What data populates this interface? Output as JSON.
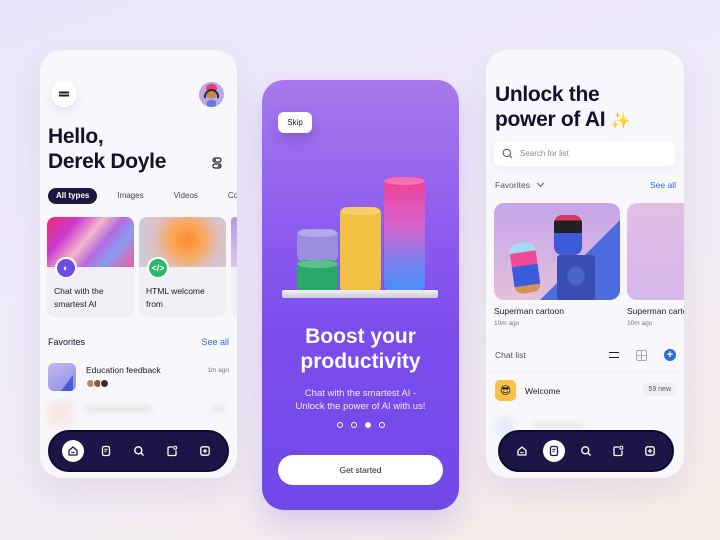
{
  "left_screen": {
    "menu_icon": "hamburger-menu-icon",
    "avatar_alt": "user-avatar",
    "greeting_line1": "Hello,",
    "greeting_line2": "Derek Doyle",
    "filter_icon": "filter-sliders-icon",
    "chips": [
      {
        "label": "All types",
        "active": true
      },
      {
        "label": "Images",
        "active": false
      },
      {
        "label": "Videos",
        "active": false
      },
      {
        "label": "Conter",
        "active": false
      }
    ],
    "cards": [
      {
        "title": "Chat with the smartest AI",
        "icon": "ai-chat-icon",
        "badge_glyph": "◐"
      },
      {
        "title": "HTML welcome from",
        "icon": "code-icon",
        "badge_glyph": "</>"
      }
    ],
    "favorites": {
      "heading": "Favorites",
      "see_all": "See all",
      "items": [
        {
          "title": "Education feedback",
          "time": "1m ago"
        }
      ]
    },
    "nav": {
      "items": [
        "home",
        "document",
        "search",
        "notification",
        "add"
      ],
      "active": "home"
    }
  },
  "center_screen": {
    "skip_label": "Skip",
    "title_line1": "Boost your",
    "title_line2": "productivity",
    "subtitle_line1": "Chat with the smartest AI -",
    "subtitle_line2": "Unlock the power of AI with us!",
    "pager": {
      "count": 4,
      "active_index": 2
    },
    "cta_label": "Get started"
  },
  "right_screen": {
    "title_line1": "Unlock the",
    "title_line2": "power of AI",
    "sparkle": "✨",
    "search_placeholder": "Search for list",
    "favorites_label": "Favorites",
    "see_all": "See all",
    "gallery": [
      {
        "title": "Superman cartoon",
        "time": "10m ago"
      },
      {
        "title": "Superman cartoon",
        "time": "10m ago"
      }
    ],
    "chat_list": {
      "heading": "Chat list",
      "items": [
        {
          "name": "Welcome",
          "badge": "59 new",
          "emoji": "😎"
        }
      ]
    },
    "nav": {
      "items": [
        "home",
        "document",
        "search",
        "notification",
        "add"
      ],
      "active": "document"
    }
  },
  "colors": {
    "accent_blue": "#2c6be6",
    "nav_dark": "#1d1545",
    "primary_purple": "#7b4cec"
  }
}
